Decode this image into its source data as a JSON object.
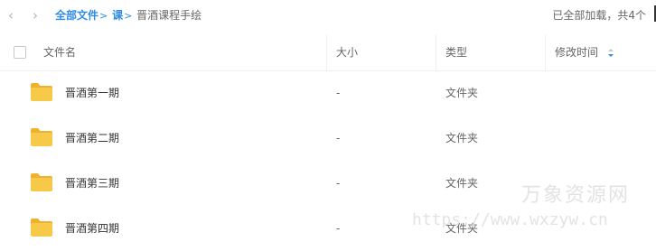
{
  "nav": {
    "back_icon": "chevron-left-icon",
    "forward_icon": "chevron-right-icon"
  },
  "breadcrumb": {
    "root": "全部文件",
    "sep": ">",
    "level1": "课",
    "current": "晋酒课程手绘"
  },
  "status": {
    "loaded_text": "已全部加载，共4个"
  },
  "table": {
    "columns": {
      "name": "文件名",
      "size": "大小",
      "type": "类型",
      "modified": "修改时间"
    },
    "sort_icon": "sort-desc-icon",
    "rows": [
      {
        "name": "晋酒第一期",
        "size": "-",
        "type": "文件夹"
      },
      {
        "name": "晋酒第二期",
        "size": "-",
        "type": "文件夹"
      },
      {
        "name": "晋酒第三期",
        "size": "-",
        "type": "文件夹"
      },
      {
        "name": "晋酒第四期",
        "size": "-",
        "type": "文件夹"
      }
    ]
  },
  "watermark": {
    "title": "万象资源网",
    "url": "https://www.wxzyw.cn"
  },
  "colors": {
    "accent": "#2e8ce6",
    "folder": "#f7c948",
    "folder_dark": "#eeb22f",
    "border": "#f0f0f0"
  }
}
